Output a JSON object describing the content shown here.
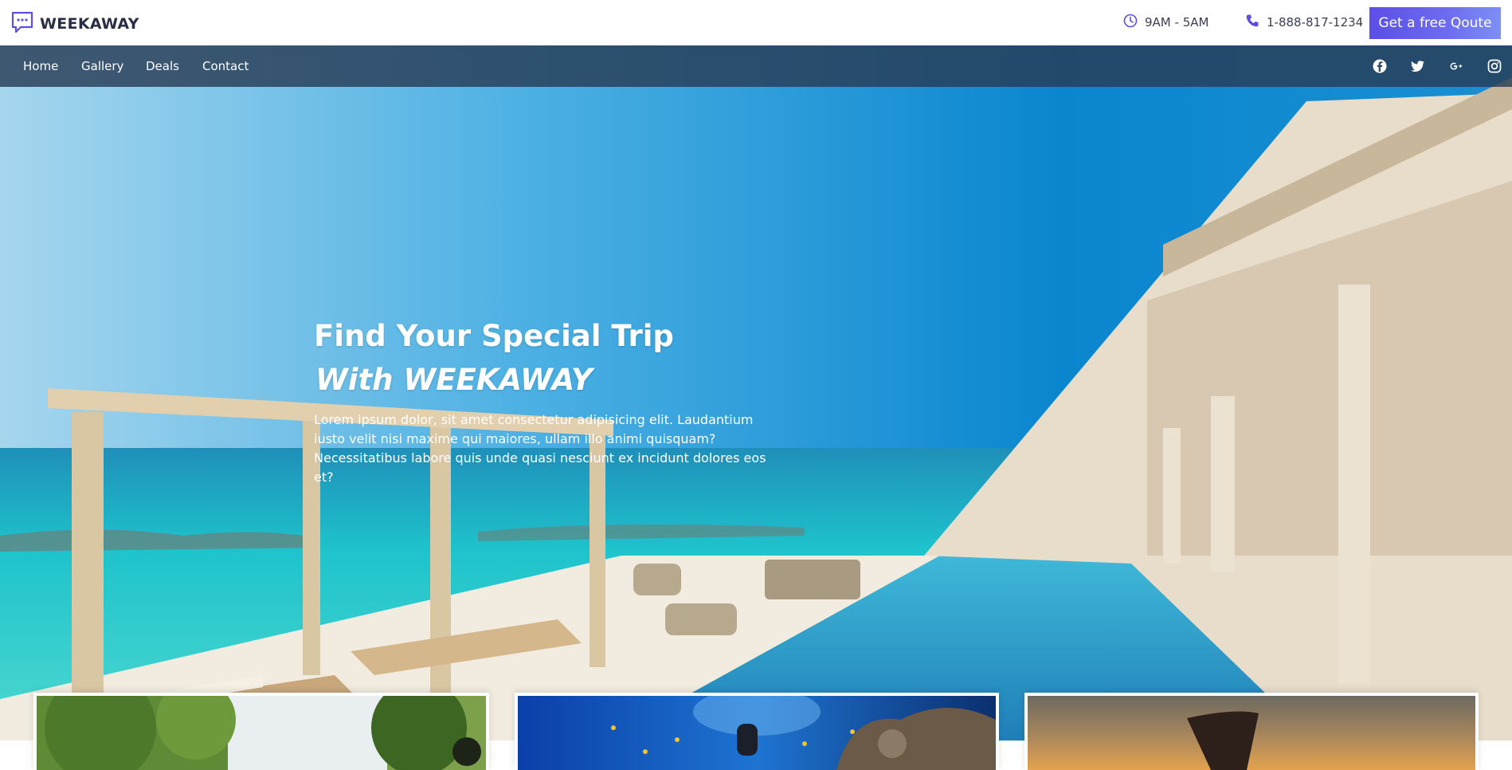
{
  "brand": {
    "name": "WEEKAWAY",
    "logo_icon": "chat-bubble-icon",
    "accent": "#5b4fe6"
  },
  "header": {
    "hours": "9AM - 5AM",
    "phone": "1-888-817-1234",
    "quote_button": "Get a free Qoute"
  },
  "nav": {
    "items": [
      "Home",
      "Gallery",
      "Deals",
      "Contact"
    ],
    "social_icons": [
      "facebook-icon",
      "twitter-icon",
      "google-plus-icon",
      "instagram-icon"
    ]
  },
  "hero": {
    "title": "Find Your Special Trip",
    "subtitle": "With WEEKAWAY",
    "text": "Lorem ipsum dolor, sit amet consectetur adipisicing elit. Laudantium iusto velit nisi maxime qui maiores, ullam illo animi quisquam? Necessitatibus labore quis unde quasi nesciunt ex incidunt dolores eos et?"
  },
  "cards": [
    {
      "image": "park-trees-image"
    },
    {
      "image": "scuba-diving-image"
    },
    {
      "image": "sunset-monument-image"
    }
  ]
}
